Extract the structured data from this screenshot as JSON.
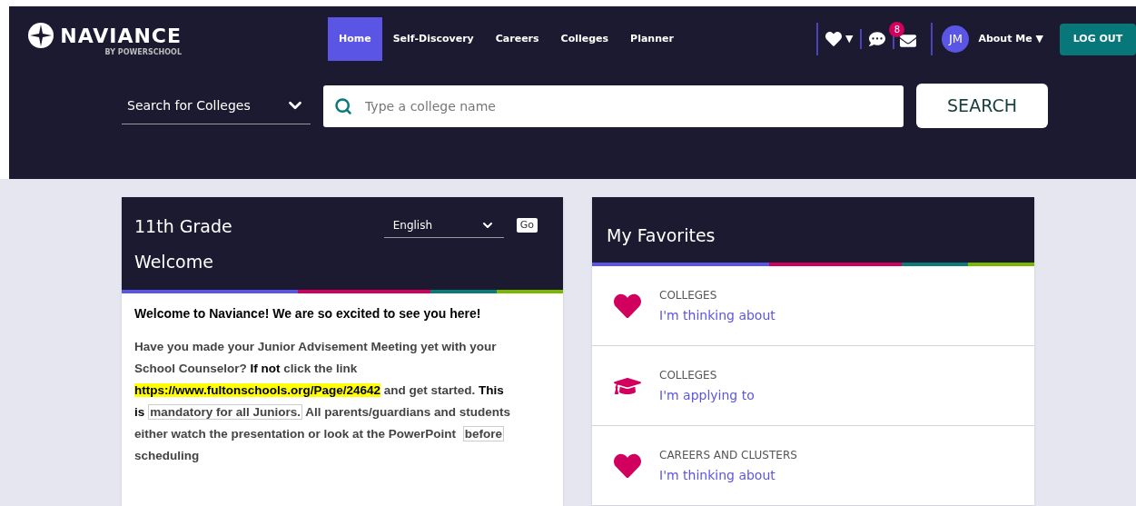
{
  "brand": {
    "name": "NAVIANCE",
    "sub": "BY POWERSCHOOL"
  },
  "nav": [
    {
      "label": "Home",
      "selected": true
    },
    {
      "label": "Self-Discovery",
      "selected": false
    },
    {
      "label": "Careers",
      "selected": false
    },
    {
      "label": "Colleges",
      "selected": false
    },
    {
      "label": "Planner",
      "selected": false
    }
  ],
  "toolbar": {
    "favorites_caret": "▼",
    "mail_badge": "8",
    "avatar": "JM",
    "user_menu": "About Me",
    "user_caret": "▼",
    "logout": "LOG OUT"
  },
  "search": {
    "scope": "Search for Colleges",
    "placeholder": "Type a college name",
    "button": "SEARCH"
  },
  "welcome_card": {
    "title_lines": [
      "11th Grade",
      "Welcome"
    ],
    "language": "English",
    "go": "Go",
    "heading": "Welcome to Naviance! We are so excited to see you here!",
    "paragraph": [
      {
        "kind": "plain",
        "text": "Have you made your Junior Advisement Meeting yet with your School Counselor? "
      },
      {
        "kind": "bold",
        "text": "If not"
      },
      {
        "kind": "plain",
        "text": " click the link "
      },
      {
        "kind": "link",
        "text": "https://www.fultonschools.org/Page/24642"
      },
      {
        "kind": "plain",
        "text": " and get started. "
      },
      {
        "kind": "bold",
        "text": "This is"
      },
      {
        "kind": "boxed",
        "text": "mandatory for all Juniors."
      },
      {
        "kind": "plain",
        "text": " All parents/guardians and students either watch the presentation or look at the PowerPoint "
      },
      {
        "kind": "boxed",
        "text": "before"
      },
      {
        "kind": "plain",
        "text": " scheduling"
      }
    ]
  },
  "favorites_card": {
    "title": "My Favorites",
    "items": [
      {
        "kind": "heart",
        "category": "COLLEGES",
        "link": "I'm thinking about"
      },
      {
        "kind": "cap",
        "category": "COLLEGES",
        "link": "I'm applying to"
      },
      {
        "kind": "heart",
        "category": "CAREERS AND CLUSTERS",
        "link": "I'm thinking about"
      }
    ]
  }
}
